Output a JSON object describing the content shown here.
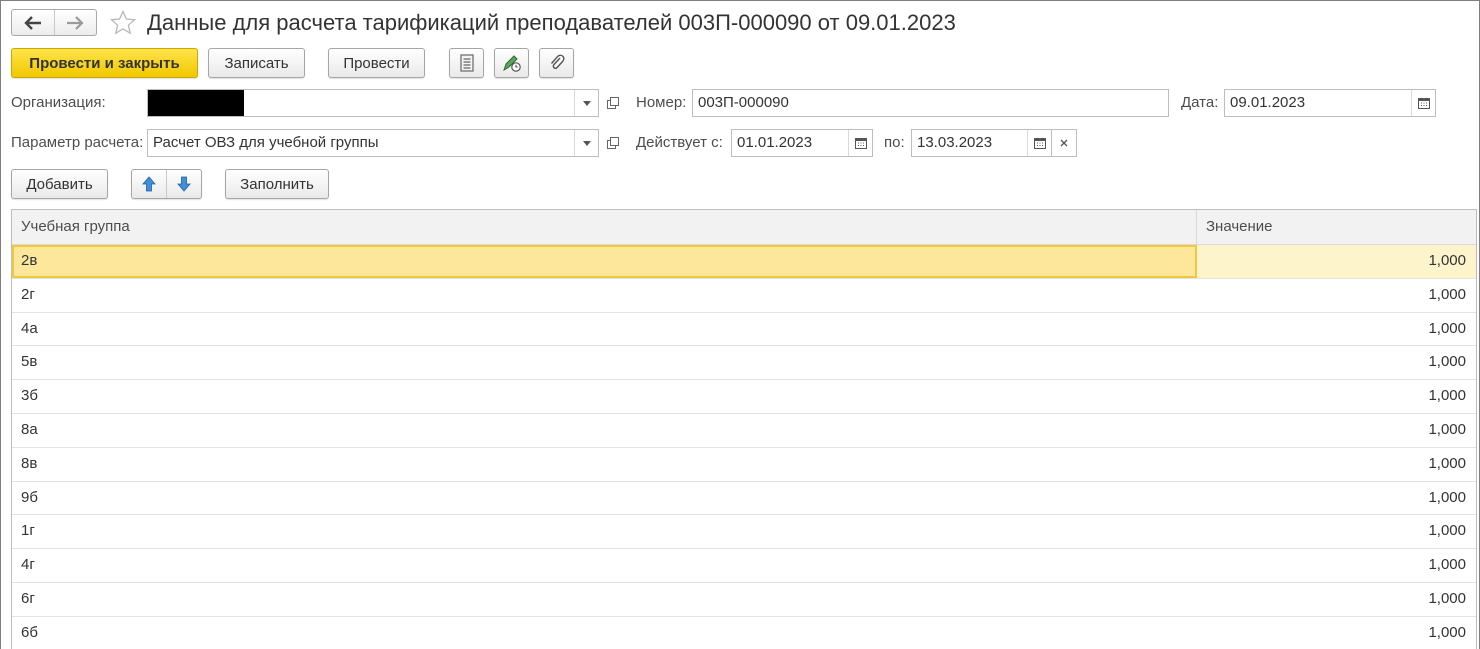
{
  "window": {
    "title": "Данные для расчета тарификаций преподавателей 003П-000090 от 09.01.2023"
  },
  "toolbar": {
    "post_close_label": "Провести и закрыть",
    "save_label": "Записать",
    "post_label": "Провести"
  },
  "form": {
    "organization_label": "Организация:",
    "organization_value": "",
    "number_label": "Номер:",
    "number_value": "003П-000090",
    "date_label": "Дата:",
    "date_value": "09.01.2023",
    "param_label": "Параметр расчета:",
    "param_value": "Расчет ОВЗ для учебной группы",
    "valid_from_label": "Действует с:",
    "valid_from_value": "01.01.2023",
    "valid_to_label": "по:",
    "valid_to_value": "13.03.2023"
  },
  "table_toolbar": {
    "add_label": "Добавить",
    "fill_label": "Заполнить"
  },
  "table": {
    "columns": [
      "Учебная группа",
      "Значение"
    ],
    "rows": [
      {
        "group": "2в",
        "value": "1,000",
        "selected": true
      },
      {
        "group": "2г",
        "value": "1,000"
      },
      {
        "group": "4а",
        "value": "1,000"
      },
      {
        "group": "5в",
        "value": "1,000"
      },
      {
        "group": "3б",
        "value": "1,000"
      },
      {
        "group": "8а",
        "value": "1,000"
      },
      {
        "group": "8в",
        "value": "1,000"
      },
      {
        "group": "9б",
        "value": "1,000"
      },
      {
        "group": "1г",
        "value": "1,000"
      },
      {
        "group": "4г",
        "value": "1,000"
      },
      {
        "group": "6г",
        "value": "1,000"
      },
      {
        "group": "6б",
        "value": "1,000"
      }
    ]
  },
  "colors": {
    "primary_button": "#f5d10f",
    "selected_row": "#fce79b",
    "arrow_blue": "#3f8fd8"
  }
}
